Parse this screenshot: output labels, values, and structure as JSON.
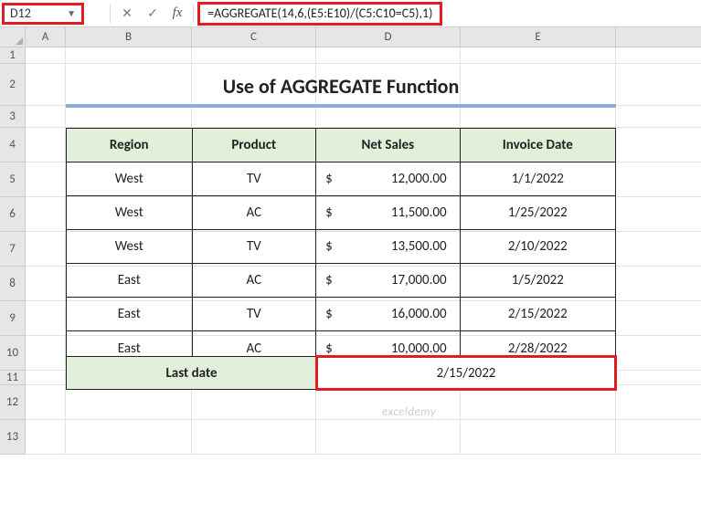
{
  "namebox": {
    "cell": "D12"
  },
  "formula_bar": {
    "cancel_glyph": "✕",
    "enter_glyph": "✓",
    "fx_label": "fx",
    "formula": "=AGGREGATE(14,6,(E5:E10)/(C5:C10=C5),1)"
  },
  "columns": {
    "A": "A",
    "B": "B",
    "C": "C",
    "D": "D",
    "E": "E"
  },
  "row_labels": [
    "1",
    "2",
    "3",
    "4",
    "5",
    "6",
    "7",
    "8",
    "9",
    "10",
    "11",
    "12",
    "13"
  ],
  "title": "Use of AGGREGATE Function",
  "table": {
    "headers": {
      "region": "Region",
      "product": "Product",
      "net_sales": "Net Sales",
      "invoice_date": "Invoice Date"
    },
    "currency_symbol": "$",
    "rows": [
      {
        "region": "West",
        "product": "TV",
        "net_sales": "12,000.00",
        "invoice_date": "1/1/2022"
      },
      {
        "region": "West",
        "product": "AC",
        "net_sales": "11,500.00",
        "invoice_date": "1/25/2022"
      },
      {
        "region": "West",
        "product": "TV",
        "net_sales": "13,500.00",
        "invoice_date": "2/10/2022"
      },
      {
        "region": "East",
        "product": "AC",
        "net_sales": "17,000.00",
        "invoice_date": "1/5/2022"
      },
      {
        "region": "East",
        "product": "TV",
        "net_sales": "16,000.00",
        "invoice_date": "2/15/2022"
      },
      {
        "region": "East",
        "product": "AC",
        "net_sales": "10,000.00",
        "invoice_date": "2/28/2022"
      }
    ]
  },
  "result": {
    "label": "Last date",
    "value": "2/15/2022"
  },
  "watermark": "exceldemy"
}
